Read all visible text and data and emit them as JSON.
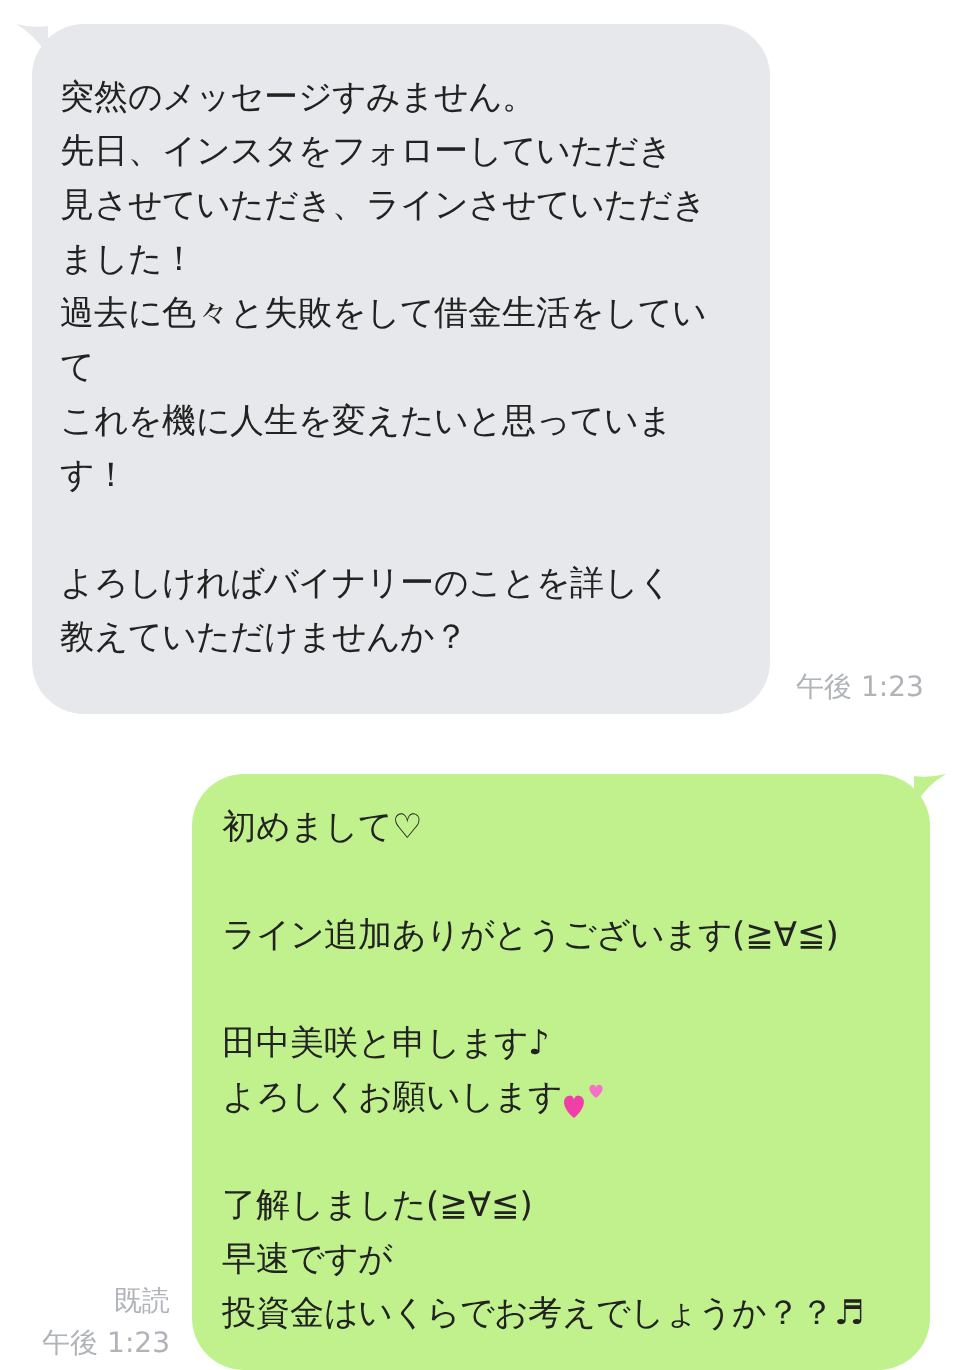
{
  "messages": [
    {
      "kind": "incoming",
      "time": "午後 1:23",
      "paragraphs": [
        [
          {
            "text": "突然のメッセージすみません。"
          },
          {
            "text": "先日、インスタをフォローしていただき"
          },
          {
            "text": "見させていただき、ラインさせていただき"
          },
          {
            "text": "ました！"
          },
          {
            "text": "過去に色々と失敗をして借金生活をしてい"
          },
          {
            "text": "て"
          },
          {
            "text": "これを機に人生を変えたいと思っていま"
          },
          {
            "text": "す！"
          }
        ],
        [
          {
            "text": "よろしければバイナリーのことを詳しく"
          },
          {
            "text": "教えていただけませんか？"
          }
        ]
      ]
    },
    {
      "kind": "outgoing",
      "read": "既読",
      "time": "午後 1:23",
      "paragraphs": [
        [
          {
            "text": "初めまして♡"
          }
        ],
        [
          {
            "text": "ライン追加ありがとうございます(≧∀≦)"
          }
        ],
        [
          {
            "text": "田中美咲と申します♪"
          },
          {
            "text": "よろしくお願いします",
            "emoji": true
          }
        ],
        [
          {
            "text": "了解しました(≧∀≦)"
          },
          {
            "text": "早速ですが"
          },
          {
            "text": "投資金はいくらでお考えでしょうか？？♬"
          }
        ]
      ]
    }
  ]
}
